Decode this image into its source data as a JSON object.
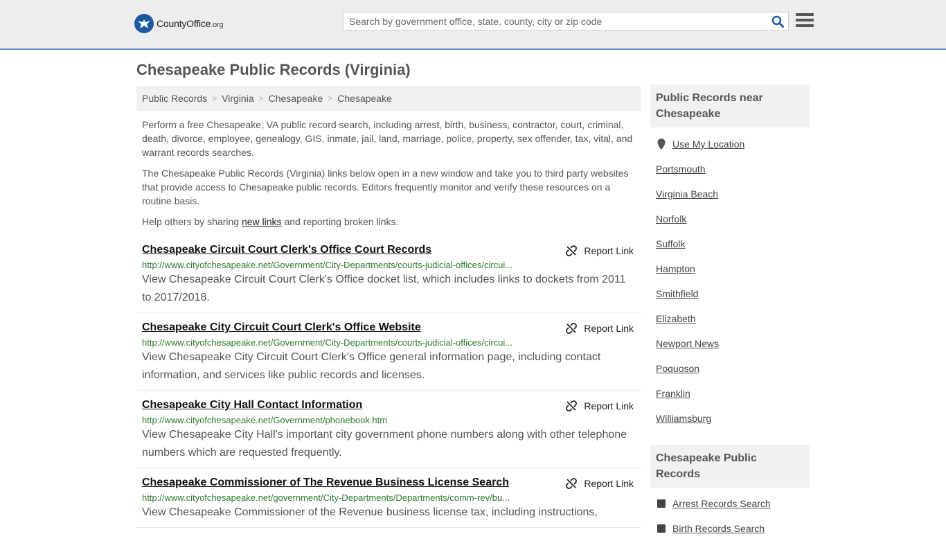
{
  "brand": {
    "name": "CountyOffice",
    "tld": ".org",
    "accent": "#1f5aa0"
  },
  "search": {
    "placeholder": "Search by government office, state, county, city or zip code"
  },
  "page": {
    "title": "Chesapeake Public Records (Virginia)"
  },
  "breadcrumb": [
    "Public Records",
    "Virginia",
    "Chesapeake",
    "Chesapeake"
  ],
  "intro": {
    "p1": "Perform a free Chesapeake, VA public record search, including arrest, birth, business, contractor, court, criminal, death, divorce, employee, genealogy, GIS, inmate, jail, land, marriage, police, property, sex offender, tax, vital, and warrant records searches.",
    "p2": "The Chesapeake Public Records (Virginia) links below open in a new window and take you to third party websites that provide access to Chesapeake public records. Editors frequently monitor and verify these resources on a routine basis.",
    "p3_before": "Help others by sharing ",
    "p3_link": "new links",
    "p3_after": " and reporting broken links."
  },
  "report_label": "Report Link",
  "records": [
    {
      "title": "Chesapeake Circuit Court Clerk's Office Court Records",
      "url": "http://www.cityofchesapeake.net/Government/City-Departments/courts-judicial-offices/circui...",
      "desc": "View Chesapeake Circuit Court Clerk's Office docket list, which includes links to dockets from 2011 to 2017/2018."
    },
    {
      "title": "Chesapeake City Circuit Court Clerk's Office Website",
      "url": "http://www.cityofchesapeake.net/Government/City-Departments/courts-judicial-offices/circui...",
      "desc": "View Chesapeake City Circuit Court Clerk's Office general information page, including contact information, and services like public records and licenses."
    },
    {
      "title": "Chesapeake City Hall Contact Information",
      "url": "http://www.cityofchesapeake.net/Government/phonebook.htm",
      "desc": "View Chesapeake City Hall's important city government phone numbers along with other telephone numbers which are requested frequently."
    },
    {
      "title": "Chesapeake Commissioner of The Revenue Business License Search",
      "url": "http://www.cityofchesapeake.net/government/City-Departments/Departments/comm-rev/bu...",
      "desc": "View Chesapeake Commissioner of the Revenue business license tax, including instructions,"
    }
  ],
  "sidebar": {
    "near_title": "Public Records near Chesapeake",
    "use_location": "Use My Location",
    "nearby": [
      "Portsmouth",
      "Virginia Beach",
      "Norfolk",
      "Suffolk",
      "Hampton",
      "Smithfield",
      "Elizabeth",
      "Newport News",
      "Poquoson",
      "Franklin",
      "Williamsburg"
    ],
    "records_title": "Chesapeake Public Records",
    "record_links": [
      "Arrest Records Search",
      "Birth Records Search"
    ]
  }
}
